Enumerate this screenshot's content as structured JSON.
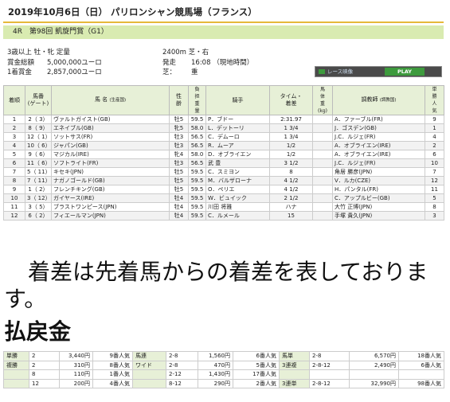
{
  "header": {
    "title": "2019年10月6日（日） パリロンシャン競馬場（フランス）",
    "race_no": "4R",
    "race_name": "第98回 凱旋門賞（G1）"
  },
  "info": {
    "conditions": "3歳以上 牡・牝 定量",
    "distance": "2400m 芝・右",
    "total_prize_label": "賞金総額",
    "total_prize": "5,000,000ユーロ",
    "start_label": "発走",
    "start": "16:08 （現地時間）",
    "first_prize_label": "1着賞金",
    "first_prize": "2,857,000ユーロ",
    "going_label": "芝：",
    "going": "重"
  },
  "video": {
    "label": "レース映像",
    "play": "PLAY"
  },
  "table": {
    "headers": {
      "rank": "着順",
      "num": "馬番\n(ゲート)",
      "horse": "馬 名",
      "origin": "(生産国)",
      "sexage": "性\n齢",
      "weight": "負\n担\n重\n量",
      "jockey": "騎手",
      "time": "タイム・\n着差",
      "bodyweight": "馬\n体\n重\n(kg)",
      "trainer": "調教師",
      "origin2": "(調教国)",
      "fav": "単\n勝\n人\n気"
    },
    "rows": [
      {
        "rank": "1",
        "num": "2（ 3）",
        "horse": "ヴァルトガイスト(GB)",
        "sexage": "牡5",
        "weight": "59.5",
        "jockey": "P．ブドー",
        "time": "2:31.97",
        "bw": "",
        "trainer": "A．ファーブル(FR)",
        "fav": "9"
      },
      {
        "rank": "2",
        "num": "8（ 9）",
        "horse": "エネイブル(GB)",
        "sexage": "牝5",
        "weight": "58.0",
        "jockey": "L．デットーリ",
        "time": "1 3/4",
        "bw": "",
        "trainer": "J．ゴスデン(GB)",
        "fav": "1"
      },
      {
        "rank": "3",
        "num": "12（ 1）",
        "horse": "ソットサス(FR)",
        "sexage": "牡3",
        "weight": "56.5",
        "jockey": "C．デムーロ",
        "time": "1 3/4",
        "bw": "",
        "trainer": "J.C．ルジェ(FR)",
        "fav": "4"
      },
      {
        "rank": "4",
        "num": "10（ 6）",
        "horse": "ジャパン(GB)",
        "sexage": "牡3",
        "weight": "56.5",
        "jockey": "R．ムーア",
        "time": "1/2",
        "bw": "",
        "trainer": "A．オブライエン(IRE)",
        "fav": "2"
      },
      {
        "rank": "5",
        "num": "9（ 6）",
        "horse": "マジカル(IRE)",
        "sexage": "牝4",
        "weight": "58.0",
        "jockey": "D．オブライエン",
        "time": "1/2",
        "bw": "",
        "trainer": "A．オブライエン(IRE)",
        "fav": "6"
      },
      {
        "rank": "6",
        "num": "11（ 6）",
        "horse": "ソフトライト(FR)",
        "sexage": "牡3",
        "weight": "56.5",
        "jockey": "武 豊",
        "time": "3 1/2",
        "bw": "",
        "trainer": "J.C．ルジェ(FR)",
        "fav": "10"
      },
      {
        "rank": "7",
        "num": "5（ 11）",
        "horse": "キセキ(JPN)",
        "sexage": "牡5",
        "weight": "59.5",
        "jockey": "C．スミヨン",
        "time": "8",
        "bw": "",
        "trainer": "角居 勝彦(JPN)",
        "fav": "7"
      },
      {
        "rank": "8",
        "num": "7（ 11）",
        "horse": "ナガノゴールド(GB)",
        "sexage": "牡5",
        "weight": "59.5",
        "jockey": "M．バルザローナ",
        "time": "4 1/2",
        "bw": "",
        "trainer": "V．ルカ(CZE)",
        "fav": "12"
      },
      {
        "rank": "9",
        "num": "1（ 2）",
        "horse": "フレンチキング(GB)",
        "sexage": "牡5",
        "weight": "59.5",
        "jockey": "O．ペリエ",
        "time": "4 1/2",
        "bw": "",
        "trainer": "H．パンタル(FR)",
        "fav": "11"
      },
      {
        "rank": "10",
        "num": "3（ 12）",
        "horse": "ガイヤース(IRE)",
        "sexage": "牡4",
        "weight": "59.5",
        "jockey": "W．ビュイック",
        "time": "2 1/2",
        "bw": "",
        "trainer": "C．アップルビー(GB)",
        "fav": "5"
      },
      {
        "rank": "11",
        "num": "3（ 5）",
        "horse": "ブラストワンピース(JPN)",
        "sexage": "牡4",
        "weight": "59.5",
        "jockey": "川田 将雅",
        "time": "ハナ",
        "bw": "",
        "trainer": "大竹 正博(JPN)",
        "fav": "8"
      },
      {
        "rank": "12",
        "num": "6（ 2）",
        "horse": "フィエールマン(JPN)",
        "sexage": "牡4",
        "weight": "59.5",
        "jockey": "C．ルメール",
        "time": "15",
        "bw": "",
        "trainer": "手塚 貴久(JPN)",
        "fav": "3"
      }
    ]
  },
  "note": "着差は先着馬からの着差を表しております。",
  "payout": {
    "title": "払戻金",
    "rows": [
      [
        "単勝",
        "2",
        "3,440円",
        "9番人気",
        "馬連",
        "2-8",
        "1,560円",
        "6番人気",
        "馬単",
        "2-8",
        "6,570円",
        "18番人気"
      ],
      [
        "複勝",
        "2",
        "310円",
        "8番人気",
        "ワイド",
        "2-8",
        "470円",
        "5番人気",
        "3連複",
        "2-8-12",
        "2,490円",
        "6番人気"
      ],
      [
        "",
        "8",
        "110円",
        "1番人気",
        "",
        "2-12",
        "1,430円",
        "17番人気",
        "",
        "",
        "",
        ""
      ],
      [
        "",
        "12",
        "200円",
        "4番人気",
        "",
        "8-12",
        "290円",
        "2番人気",
        "3連単",
        "2-8-12",
        "32,990円",
        "98番人気"
      ]
    ]
  }
}
